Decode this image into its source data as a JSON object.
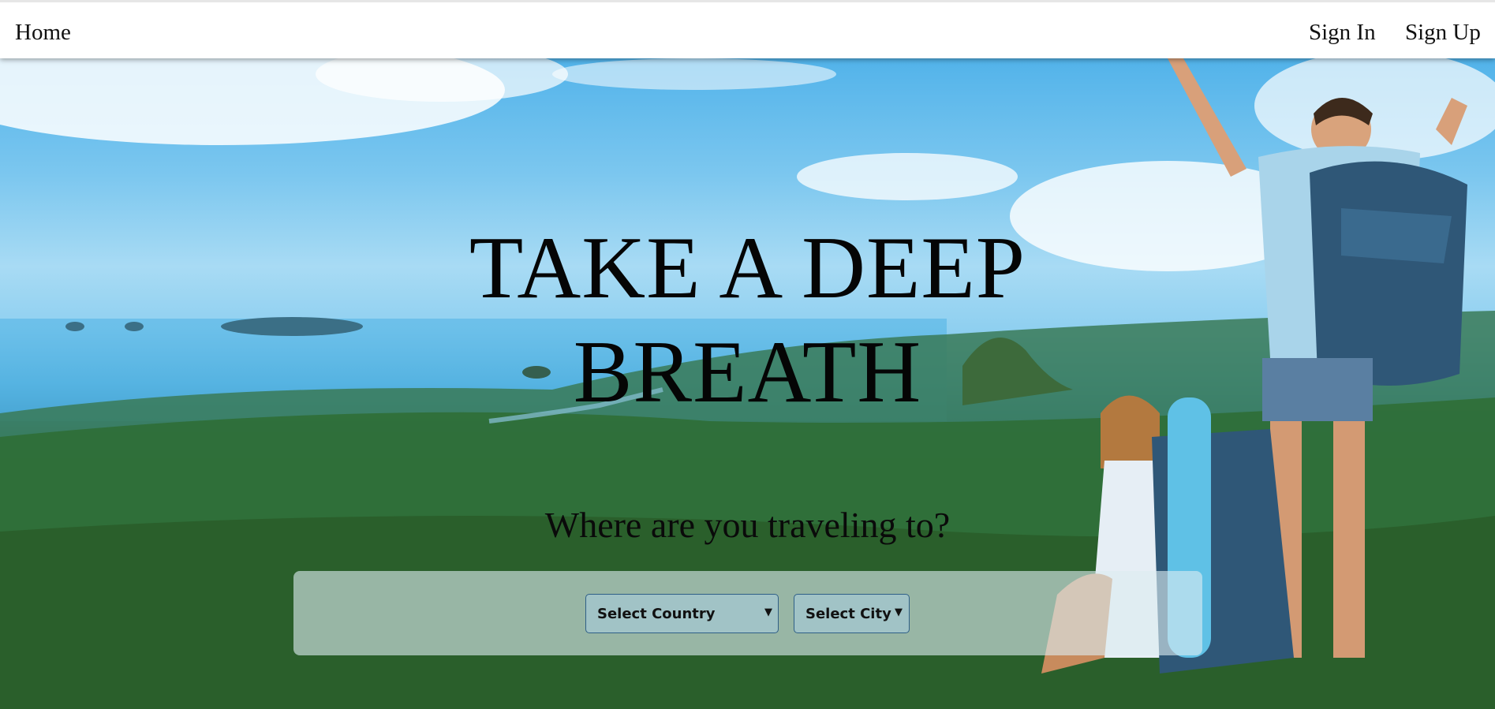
{
  "nav": {
    "home": "Home",
    "sign_in": "Sign In",
    "sign_up": "Sign Up"
  },
  "hero": {
    "title_line1": "TAKE A DEEP",
    "title_line2": "BREATH",
    "subtitle": "Where are you traveling to?",
    "background_image": "hikers-on-mountain-overlooking-sea-photo"
  },
  "search": {
    "country_select": {
      "selected": "Select Country"
    },
    "city_select": {
      "selected": "Select City"
    },
    "dropdown_icon": "caret-down-icon"
  },
  "colors": {
    "nav_bg": "#ffffff",
    "select_border": "#2f5f87",
    "panel_bg": "rgba(220,235,240,0.62)"
  }
}
